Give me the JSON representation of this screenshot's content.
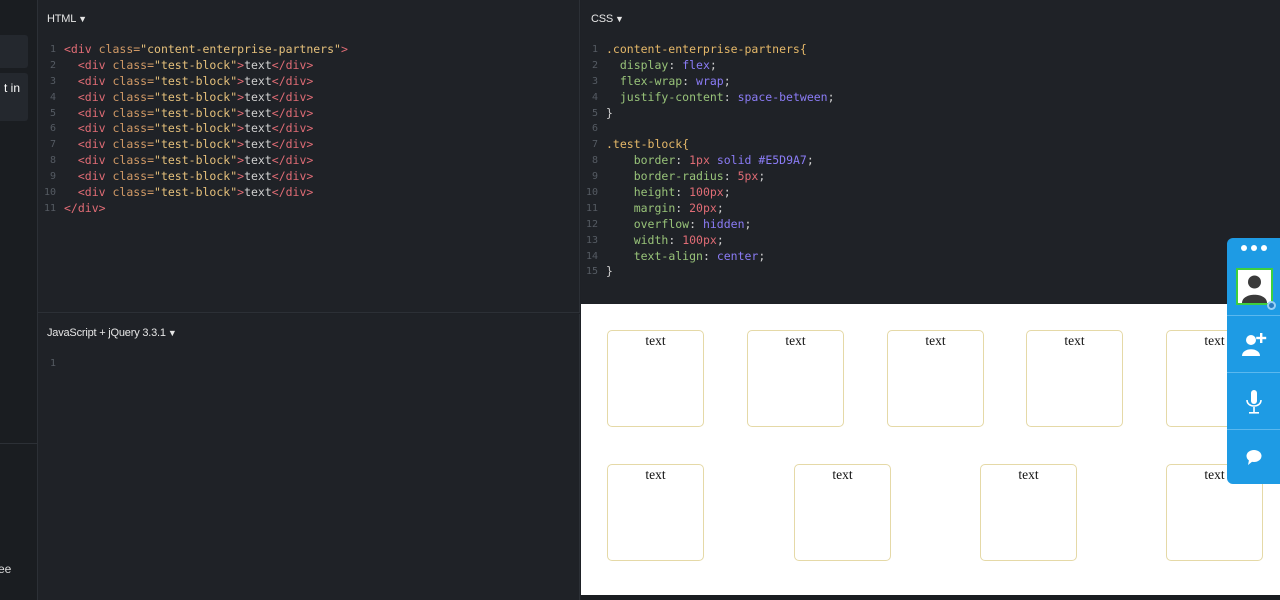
{
  "sidebar": {
    "text_in": "t in",
    "text_ee": "ee"
  },
  "html_panel": {
    "title": "HTML",
    "lines": [
      {
        "n": "1",
        "parts": [
          [
            "tag",
            "<div "
          ],
          [
            "attr",
            "class="
          ],
          [
            "str",
            "\"content-enterprise-partners\""
          ],
          [
            "tag",
            ">"
          ]
        ]
      },
      {
        "n": "2",
        "parts": [
          [
            "txt",
            "  "
          ],
          [
            "tag",
            "<div "
          ],
          [
            "attr",
            "class="
          ],
          [
            "str",
            "\"test-block\""
          ],
          [
            "tag",
            ">"
          ],
          [
            "txt",
            "text"
          ],
          [
            "tag",
            "</div>"
          ]
        ]
      },
      {
        "n": "3",
        "parts": [
          [
            "txt",
            "  "
          ],
          [
            "tag",
            "<div "
          ],
          [
            "attr",
            "class="
          ],
          [
            "str",
            "\"test-block\""
          ],
          [
            "tag",
            ">"
          ],
          [
            "txt",
            "text"
          ],
          [
            "tag",
            "</div>"
          ]
        ]
      },
      {
        "n": "4",
        "parts": [
          [
            "txt",
            "  "
          ],
          [
            "tag",
            "<div "
          ],
          [
            "attr",
            "class="
          ],
          [
            "str",
            "\"test-block\""
          ],
          [
            "tag",
            ">"
          ],
          [
            "txt",
            "text"
          ],
          [
            "tag",
            "</div>"
          ]
        ]
      },
      {
        "n": "5",
        "parts": [
          [
            "txt",
            "  "
          ],
          [
            "tag",
            "<div "
          ],
          [
            "attr",
            "class="
          ],
          [
            "str",
            "\"test-block\""
          ],
          [
            "tag",
            ">"
          ],
          [
            "txt",
            "text"
          ],
          [
            "tag",
            "</div>"
          ]
        ]
      },
      {
        "n": "6",
        "parts": [
          [
            "txt",
            "  "
          ],
          [
            "tag",
            "<div "
          ],
          [
            "attr",
            "class="
          ],
          [
            "str",
            "\"test-block\""
          ],
          [
            "tag",
            ">"
          ],
          [
            "txt",
            "text"
          ],
          [
            "tag",
            "</div>"
          ]
        ]
      },
      {
        "n": "7",
        "parts": [
          [
            "txt",
            "  "
          ],
          [
            "tag",
            "<div "
          ],
          [
            "attr",
            "class="
          ],
          [
            "str",
            "\"test-block\""
          ],
          [
            "tag",
            ">"
          ],
          [
            "txt",
            "text"
          ],
          [
            "tag",
            "</div>"
          ]
        ]
      },
      {
        "n": "8",
        "parts": [
          [
            "txt",
            "  "
          ],
          [
            "tag",
            "<div "
          ],
          [
            "attr",
            "class="
          ],
          [
            "str",
            "\"test-block\""
          ],
          [
            "tag",
            ">"
          ],
          [
            "txt",
            "text"
          ],
          [
            "tag",
            "</div>"
          ]
        ]
      },
      {
        "n": "9",
        "parts": [
          [
            "txt",
            "  "
          ],
          [
            "tag",
            "<div "
          ],
          [
            "attr",
            "class="
          ],
          [
            "str",
            "\"test-block\""
          ],
          [
            "tag",
            ">"
          ],
          [
            "txt",
            "text"
          ],
          [
            "tag",
            "</div>"
          ]
        ]
      },
      {
        "n": "10",
        "parts": [
          [
            "txt",
            "  "
          ],
          [
            "tag",
            "<div "
          ],
          [
            "attr",
            "class="
          ],
          [
            "str",
            "\"test-block\""
          ],
          [
            "tag",
            ">"
          ],
          [
            "txt",
            "text"
          ],
          [
            "tag",
            "</div>"
          ]
        ]
      },
      {
        "n": "11",
        "parts": [
          [
            "tag",
            "</div>"
          ]
        ]
      }
    ]
  },
  "css_panel": {
    "title": "CSS",
    "lines": [
      {
        "n": "1",
        "parts": [
          [
            "sel",
            ".content-enterprise-partners{"
          ]
        ]
      },
      {
        "n": "2",
        "parts": [
          [
            "pun",
            "  "
          ],
          [
            "prop",
            "display"
          ],
          [
            "pun",
            ": "
          ],
          [
            "val",
            "flex"
          ],
          [
            "pun",
            ";"
          ]
        ]
      },
      {
        "n": "3",
        "parts": [
          [
            "pun",
            "  "
          ],
          [
            "prop",
            "flex-wrap"
          ],
          [
            "pun",
            ": "
          ],
          [
            "val",
            "wrap"
          ],
          [
            "pun",
            ";"
          ]
        ]
      },
      {
        "n": "4",
        "parts": [
          [
            "pun",
            "  "
          ],
          [
            "prop",
            "justify-content"
          ],
          [
            "pun",
            ": "
          ],
          [
            "val",
            "space-between"
          ],
          [
            "pun",
            ";"
          ]
        ]
      },
      {
        "n": "5",
        "parts": [
          [
            "pun",
            "}"
          ]
        ]
      },
      {
        "n": "6",
        "parts": []
      },
      {
        "n": "7",
        "parts": [
          [
            "sel",
            ".test-block{"
          ]
        ]
      },
      {
        "n": "8",
        "parts": [
          [
            "pun",
            "    "
          ],
          [
            "prop",
            "border"
          ],
          [
            "pun",
            ": "
          ],
          [
            "num",
            "1px"
          ],
          [
            "pun",
            " "
          ],
          [
            "val",
            "solid"
          ],
          [
            "pun",
            " "
          ],
          [
            "val",
            "#E5D9A7"
          ],
          [
            "pun",
            ";"
          ]
        ]
      },
      {
        "n": "9",
        "parts": [
          [
            "pun",
            "    "
          ],
          [
            "prop",
            "border-radius"
          ],
          [
            "pun",
            ": "
          ],
          [
            "num",
            "5px"
          ],
          [
            "pun",
            ";"
          ]
        ]
      },
      {
        "n": "10",
        "parts": [
          [
            "pun",
            "    "
          ],
          [
            "prop",
            "height"
          ],
          [
            "pun",
            ": "
          ],
          [
            "num",
            "100px"
          ],
          [
            "pun",
            ";"
          ]
        ]
      },
      {
        "n": "11",
        "parts": [
          [
            "pun",
            "    "
          ],
          [
            "prop",
            "margin"
          ],
          [
            "pun",
            ": "
          ],
          [
            "num",
            "20px"
          ],
          [
            "pun",
            ";"
          ]
        ]
      },
      {
        "n": "12",
        "parts": [
          [
            "pun",
            "    "
          ],
          [
            "prop",
            "overflow"
          ],
          [
            "pun",
            ": "
          ],
          [
            "val",
            "hidden"
          ],
          [
            "pun",
            ";"
          ]
        ]
      },
      {
        "n": "13",
        "parts": [
          [
            "pun",
            "    "
          ],
          [
            "prop",
            "width"
          ],
          [
            "pun",
            ": "
          ],
          [
            "num",
            "100px"
          ],
          [
            "pun",
            ";"
          ]
        ]
      },
      {
        "n": "14",
        "parts": [
          [
            "pun",
            "    "
          ],
          [
            "prop",
            "text-align"
          ],
          [
            "pun",
            ": "
          ],
          [
            "val",
            "center"
          ],
          [
            "pun",
            ";"
          ]
        ]
      },
      {
        "n": "15",
        "parts": [
          [
            "pun",
            "}"
          ]
        ]
      }
    ]
  },
  "js_panel": {
    "title": "JavaScript + jQuery 3.3.1",
    "lines": [
      {
        "n": "1",
        "parts": []
      }
    ]
  },
  "preview": {
    "blocks": [
      "text",
      "text",
      "text",
      "text",
      "text",
      "text",
      "text",
      "text",
      "text"
    ]
  },
  "colors": {
    "widget": "#1e9be4",
    "avatar_border": "#3ecf3e",
    "block_border": "#E5D9A7"
  },
  "widget": {
    "icons": [
      "more-dots-icon",
      "avatar-icon",
      "add-contact-icon",
      "microphone-icon",
      "chat-bubble-icon"
    ]
  }
}
